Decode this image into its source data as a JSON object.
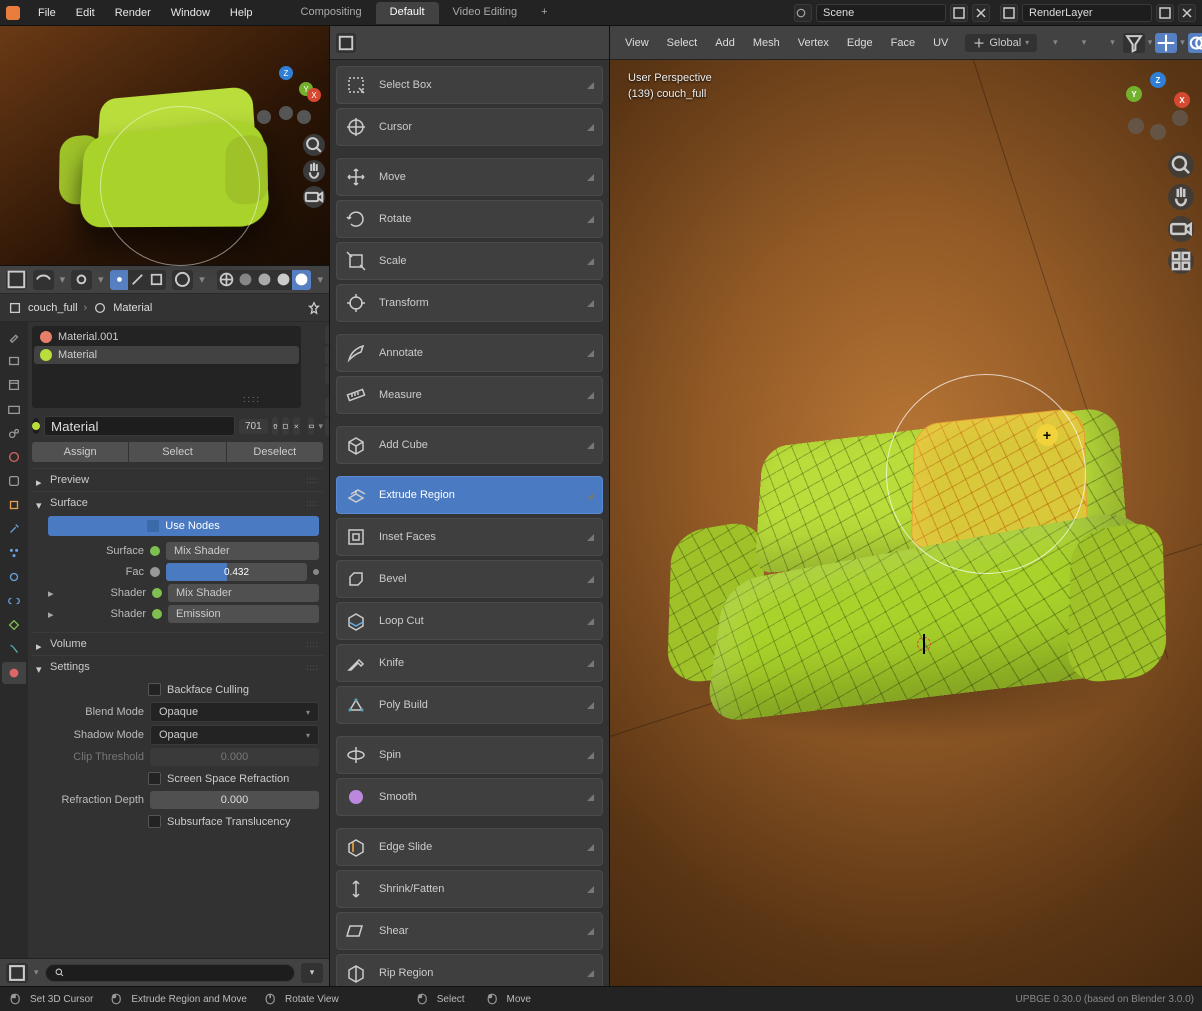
{
  "top": {
    "file": "File",
    "edit": "Edit",
    "render": "Render",
    "window": "Window",
    "help": "Help",
    "workspaces": [
      "Compositing",
      "Default",
      "Video Editing"
    ],
    "active_workspace": 1,
    "scene_label": "Scene",
    "layer_label": "RenderLayer"
  },
  "breadcrumb": {
    "object": "couch_full",
    "material": "Material"
  },
  "materials_list": [
    {
      "name": "Material.001",
      "color": "#e87d6a"
    },
    {
      "name": "Material",
      "color": "#b9dd3a"
    }
  ],
  "material_active_index": 1,
  "material_name": "Material",
  "material_users": "701",
  "assign": {
    "assign": "Assign",
    "select": "Select",
    "deselect": "Deselect"
  },
  "panels": {
    "preview": "Preview",
    "surface": "Surface",
    "volume": "Volume",
    "settings": "Settings"
  },
  "surface": {
    "use_nodes": "Use Nodes",
    "surface_label": "Surface",
    "surface_val": "Mix Shader",
    "fac_label": "Fac",
    "fac_val": "0.432",
    "fac_frac": 0.432,
    "shader_label": "Shader",
    "shader1_val": "Mix Shader",
    "shader2_val": "Emission"
  },
  "settings": {
    "backface": "Backface Culling",
    "blend_label": "Blend Mode",
    "blend_val": "Opaque",
    "shadow_label": "Shadow Mode",
    "shadow_val": "Opaque",
    "clip_label": "Clip Threshold",
    "clip_val": "0.000",
    "ssr": "Screen Space Refraction",
    "refr_label": "Refraction Depth",
    "refr_val": "0.000",
    "sst": "Subsurface Translucency"
  },
  "tools": [
    {
      "name": "Select Box",
      "icon": "select"
    },
    {
      "name": "Cursor",
      "icon": "cursor"
    },
    "sep",
    {
      "name": "Move",
      "icon": "move"
    },
    {
      "name": "Rotate",
      "icon": "rotate"
    },
    {
      "name": "Scale",
      "icon": "scale"
    },
    {
      "name": "Transform",
      "icon": "transform"
    },
    "sep",
    {
      "name": "Annotate",
      "icon": "annotate"
    },
    {
      "name": "Measure",
      "icon": "measure"
    },
    "sep",
    {
      "name": "Add Cube",
      "icon": "addcube"
    },
    "sep",
    {
      "name": "Extrude Region",
      "icon": "extrude",
      "active": true
    },
    {
      "name": "Inset Faces",
      "icon": "inset"
    },
    {
      "name": "Bevel",
      "icon": "bevel"
    },
    {
      "name": "Loop Cut",
      "icon": "loopcut"
    },
    {
      "name": "Knife",
      "icon": "knife"
    },
    {
      "name": "Poly Build",
      "icon": "poly"
    },
    "sep",
    {
      "name": "Spin",
      "icon": "spin"
    },
    {
      "name": "Smooth",
      "icon": "smooth"
    },
    "sep",
    {
      "name": "Edge Slide",
      "icon": "edgeslide"
    },
    {
      "name": "Shrink/Fatten",
      "icon": "shrink"
    },
    {
      "name": "Shear",
      "icon": "shear"
    },
    {
      "name": "Rip Region",
      "icon": "rip"
    }
  ],
  "viewport": {
    "menus": [
      "View",
      "Select",
      "Add",
      "Mesh",
      "Vertex",
      "Edge",
      "Face",
      "UV"
    ],
    "orientation": "Global",
    "info_line1": "User Perspective",
    "info_line2": "(139) couch_full"
  },
  "status": {
    "set_cursor": "Set 3D Cursor",
    "extrude": "Extrude Region and Move",
    "rotate_view": "Rotate View",
    "select": "Select",
    "move": "Move",
    "version": "UPBGE 0.30.0 (based on Blender 3.0.0)"
  }
}
